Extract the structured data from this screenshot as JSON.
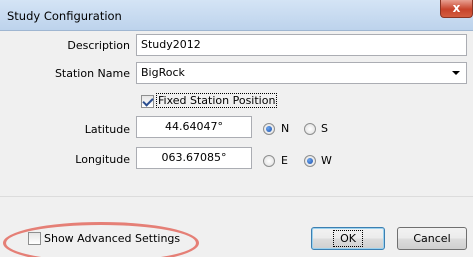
{
  "window": {
    "title": "Study Configuration",
    "close_glyph": "x"
  },
  "form": {
    "description_label": "Description",
    "description_value": "Study2012",
    "station_name_label": "Station Name",
    "station_name_value": "BigRock",
    "fixed_position_label": "Fixed Station Position",
    "fixed_position_checked": true,
    "latitude_label": "Latitude",
    "latitude_value": "44.64047°",
    "lat_n_label": "N",
    "lat_s_label": "S",
    "lat_selected": "N",
    "longitude_label": "Longitude",
    "longitude_value": "063.67085°",
    "lon_e_label": "E",
    "lon_w_label": "W",
    "lon_selected": "W"
  },
  "footer": {
    "advanced_label": "Show Advanced Settings",
    "advanced_checked": false,
    "ok_label": "OK",
    "cancel_label": "Cancel"
  },
  "colors": {
    "highlight": "#e57f76",
    "titlebar": "#c9dcf1",
    "close_button": "#c7432b"
  }
}
